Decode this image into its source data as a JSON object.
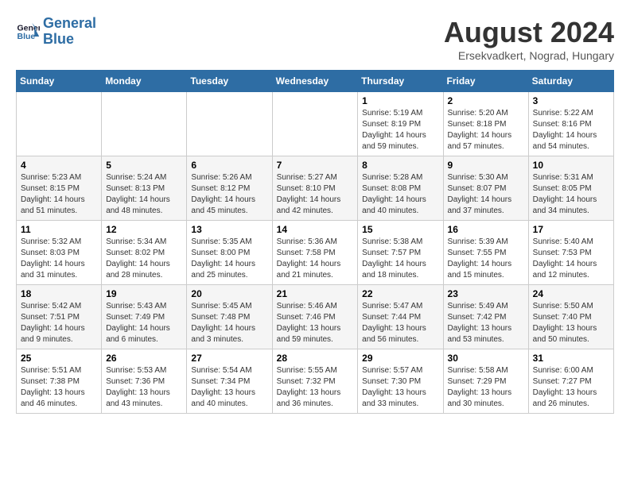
{
  "header": {
    "logo_line1": "General",
    "logo_line2": "Blue",
    "month_title": "August 2024",
    "subtitle": "Ersekvadkert, Nograd, Hungary"
  },
  "weekdays": [
    "Sunday",
    "Monday",
    "Tuesday",
    "Wednesday",
    "Thursday",
    "Friday",
    "Saturday"
  ],
  "weeks": [
    [
      {
        "day": "",
        "info": ""
      },
      {
        "day": "",
        "info": ""
      },
      {
        "day": "",
        "info": ""
      },
      {
        "day": "",
        "info": ""
      },
      {
        "day": "1",
        "info": "Sunrise: 5:19 AM\nSunset: 8:19 PM\nDaylight: 14 hours\nand 59 minutes."
      },
      {
        "day": "2",
        "info": "Sunrise: 5:20 AM\nSunset: 8:18 PM\nDaylight: 14 hours\nand 57 minutes."
      },
      {
        "day": "3",
        "info": "Sunrise: 5:22 AM\nSunset: 8:16 PM\nDaylight: 14 hours\nand 54 minutes."
      }
    ],
    [
      {
        "day": "4",
        "info": "Sunrise: 5:23 AM\nSunset: 8:15 PM\nDaylight: 14 hours\nand 51 minutes."
      },
      {
        "day": "5",
        "info": "Sunrise: 5:24 AM\nSunset: 8:13 PM\nDaylight: 14 hours\nand 48 minutes."
      },
      {
        "day": "6",
        "info": "Sunrise: 5:26 AM\nSunset: 8:12 PM\nDaylight: 14 hours\nand 45 minutes."
      },
      {
        "day": "7",
        "info": "Sunrise: 5:27 AM\nSunset: 8:10 PM\nDaylight: 14 hours\nand 42 minutes."
      },
      {
        "day": "8",
        "info": "Sunrise: 5:28 AM\nSunset: 8:08 PM\nDaylight: 14 hours\nand 40 minutes."
      },
      {
        "day": "9",
        "info": "Sunrise: 5:30 AM\nSunset: 8:07 PM\nDaylight: 14 hours\nand 37 minutes."
      },
      {
        "day": "10",
        "info": "Sunrise: 5:31 AM\nSunset: 8:05 PM\nDaylight: 14 hours\nand 34 minutes."
      }
    ],
    [
      {
        "day": "11",
        "info": "Sunrise: 5:32 AM\nSunset: 8:03 PM\nDaylight: 14 hours\nand 31 minutes."
      },
      {
        "day": "12",
        "info": "Sunrise: 5:34 AM\nSunset: 8:02 PM\nDaylight: 14 hours\nand 28 minutes."
      },
      {
        "day": "13",
        "info": "Sunrise: 5:35 AM\nSunset: 8:00 PM\nDaylight: 14 hours\nand 25 minutes."
      },
      {
        "day": "14",
        "info": "Sunrise: 5:36 AM\nSunset: 7:58 PM\nDaylight: 14 hours\nand 21 minutes."
      },
      {
        "day": "15",
        "info": "Sunrise: 5:38 AM\nSunset: 7:57 PM\nDaylight: 14 hours\nand 18 minutes."
      },
      {
        "day": "16",
        "info": "Sunrise: 5:39 AM\nSunset: 7:55 PM\nDaylight: 14 hours\nand 15 minutes."
      },
      {
        "day": "17",
        "info": "Sunrise: 5:40 AM\nSunset: 7:53 PM\nDaylight: 14 hours\nand 12 minutes."
      }
    ],
    [
      {
        "day": "18",
        "info": "Sunrise: 5:42 AM\nSunset: 7:51 PM\nDaylight: 14 hours\nand 9 minutes."
      },
      {
        "day": "19",
        "info": "Sunrise: 5:43 AM\nSunset: 7:49 PM\nDaylight: 14 hours\nand 6 minutes."
      },
      {
        "day": "20",
        "info": "Sunrise: 5:45 AM\nSunset: 7:48 PM\nDaylight: 14 hours and 3 minutes."
      },
      {
        "day": "21",
        "info": "Sunrise: 5:46 AM\nSunset: 7:46 PM\nDaylight: 13 hours\nand 59 minutes."
      },
      {
        "day": "22",
        "info": "Sunrise: 5:47 AM\nSunset: 7:44 PM\nDaylight: 13 hours\nand 56 minutes."
      },
      {
        "day": "23",
        "info": "Sunrise: 5:49 AM\nSunset: 7:42 PM\nDaylight: 13 hours\nand 53 minutes."
      },
      {
        "day": "24",
        "info": "Sunrise: 5:50 AM\nSunset: 7:40 PM\nDaylight: 13 hours\nand 50 minutes."
      }
    ],
    [
      {
        "day": "25",
        "info": "Sunrise: 5:51 AM\nSunset: 7:38 PM\nDaylight: 13 hours\nand 46 minutes."
      },
      {
        "day": "26",
        "info": "Sunrise: 5:53 AM\nSunset: 7:36 PM\nDaylight: 13 hours\nand 43 minutes."
      },
      {
        "day": "27",
        "info": "Sunrise: 5:54 AM\nSunset: 7:34 PM\nDaylight: 13 hours\nand 40 minutes."
      },
      {
        "day": "28",
        "info": "Sunrise: 5:55 AM\nSunset: 7:32 PM\nDaylight: 13 hours\nand 36 minutes."
      },
      {
        "day": "29",
        "info": "Sunrise: 5:57 AM\nSunset: 7:30 PM\nDaylight: 13 hours\nand 33 minutes."
      },
      {
        "day": "30",
        "info": "Sunrise: 5:58 AM\nSunset: 7:29 PM\nDaylight: 13 hours\nand 30 minutes."
      },
      {
        "day": "31",
        "info": "Sunrise: 6:00 AM\nSunset: 7:27 PM\nDaylight: 13 hours\nand 26 minutes."
      }
    ]
  ]
}
